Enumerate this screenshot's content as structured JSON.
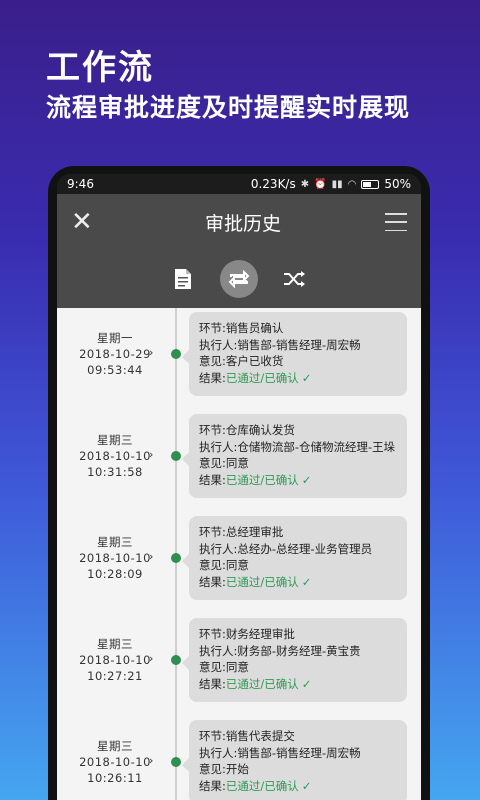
{
  "promo": {
    "title": "工作流",
    "subtitle": "流程审批进度及时提醒实时展现"
  },
  "statusbar": {
    "time": "9:46",
    "speed": "0.23K/s",
    "battery": "50%"
  },
  "appbar": {
    "title": "审批历史",
    "close_icon": "close-icon",
    "menu_icon": "hamburger-menu-icon"
  },
  "tabs": [
    {
      "icon": "document-icon",
      "active": false
    },
    {
      "icon": "repeat-icon",
      "active": true
    },
    {
      "icon": "shuffle-icon",
      "active": false
    }
  ],
  "labels": {
    "stage": "环节:",
    "executor": "执行人:",
    "opinion": "意见:",
    "result": "结果:"
  },
  "entries": [
    {
      "weekday": "星期一",
      "date": "2018-10-29",
      "time": "09:53:44",
      "stage": "销售员确认",
      "executor": "销售部-销售经理-周宏畅",
      "opinion": "客户已收货",
      "result": "已通过/已确认"
    },
    {
      "weekday": "星期三",
      "date": "2018-10-10",
      "time": "10:31:58",
      "stage": "仓库确认发货",
      "executor": "仓储物流部-仓储物流经理-王垛",
      "opinion": "同意",
      "result": "已通过/已确认"
    },
    {
      "weekday": "星期三",
      "date": "2018-10-10",
      "time": "10:28:09",
      "stage": "总经理审批",
      "executor": "总经办-总经理-业务管理员",
      "opinion": "同意",
      "result": "已通过/已确认"
    },
    {
      "weekday": "星期三",
      "date": "2018-10-10",
      "time": "10:27:21",
      "stage": "财务经理审批",
      "executor": "财务部-财务经理-黄宝贵",
      "opinion": "同意",
      "result": "已通过/已确认"
    },
    {
      "weekday": "星期三",
      "date": "2018-10-10",
      "time": "10:26:11",
      "stage": "销售代表提交",
      "executor": "销售部-销售经理-周宏畅",
      "opinion": "开始",
      "result": "已通过/已确认"
    }
  ],
  "colors": {
    "accent_green": "#2f9a55",
    "card_bg": "#dcdcdc",
    "header_bg": "#4a4a4a"
  }
}
